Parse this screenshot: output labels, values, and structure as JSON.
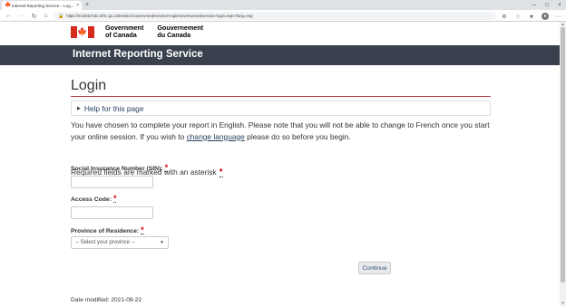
{
  "browser": {
    "tab_title": "Internet Reporting Service – Log...",
    "tab_close": "×",
    "new_tab": "+",
    "url": "https://srv265.hrdc-drhc.gc.ca/teledec/ouvertureedesession-login/ouvertureedesession-login.aspx?lang=eng",
    "window_controls": [
      "–",
      "□",
      "×"
    ]
  },
  "gc_header": {
    "gov_en_line1": "Government",
    "gov_en_line2": "of Canada",
    "gov_fr_line1": "Gouvernement",
    "gov_fr_line2": "du Canada"
  },
  "app_bar": {
    "title": "Internet Reporting Service"
  },
  "main": {
    "title": "Login",
    "help_label": "Help for this page",
    "intro_before_link": "You have chosen to complete your report in English. Please note that you will not be able to change to French once you start your online session. If you wish to ",
    "intro_link": "change language",
    "intro_after_link": " please do so before you begin.",
    "required_note": "Required fields are marked with an asterisk",
    "required_star": "*",
    "sin_label": "Social Insurance Number (SIN):",
    "access_label": "Access Code:",
    "province_label": "Province of Residence:",
    "province_selected": "-- Select your province --",
    "continue_label": "Continue",
    "date_modified": "Date modified: 2021-09-22"
  },
  "colors": {
    "app_bar_bg": "#38414d",
    "flag_red": "#d52b1e",
    "title_rule": "#af3c43",
    "required_star": "#d3080c",
    "link": "#284162"
  }
}
